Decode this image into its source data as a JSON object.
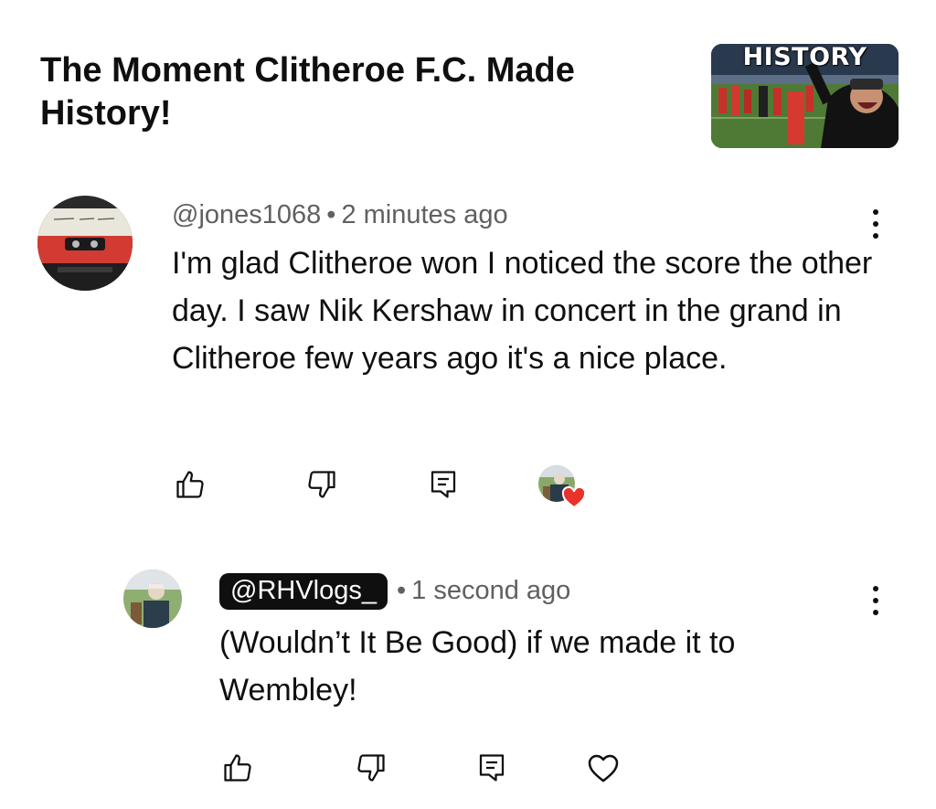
{
  "video": {
    "title": "The Moment Clitheroe F.C. Made History!",
    "thumbnail_label": "HISTORY"
  },
  "comment": {
    "author": "@jones1068",
    "separator": "•",
    "time": "2 minutes ago",
    "text": "I'm glad Clitheroe won I noticed the score the other day. I saw Nik Kershaw in concert in the grand in Clitheroe few years ago it's a nice place.",
    "avatar_icon": "cassette-tape-icon",
    "actions": [
      "like-icon",
      "dislike-icon",
      "reply-icon",
      "creator-heart-icon"
    ]
  },
  "reply": {
    "author": "@RHVlogs_",
    "separator": "•",
    "time": "1 second ago",
    "text": "(Wouldn’t It Be Good) if we made it to Wembley!",
    "actions": [
      "like-icon",
      "dislike-icon",
      "reply-icon",
      "heart-icon"
    ]
  },
  "colors": {
    "text": "#0f0f0f",
    "meta": "#606060",
    "heart": "#e8322c"
  }
}
